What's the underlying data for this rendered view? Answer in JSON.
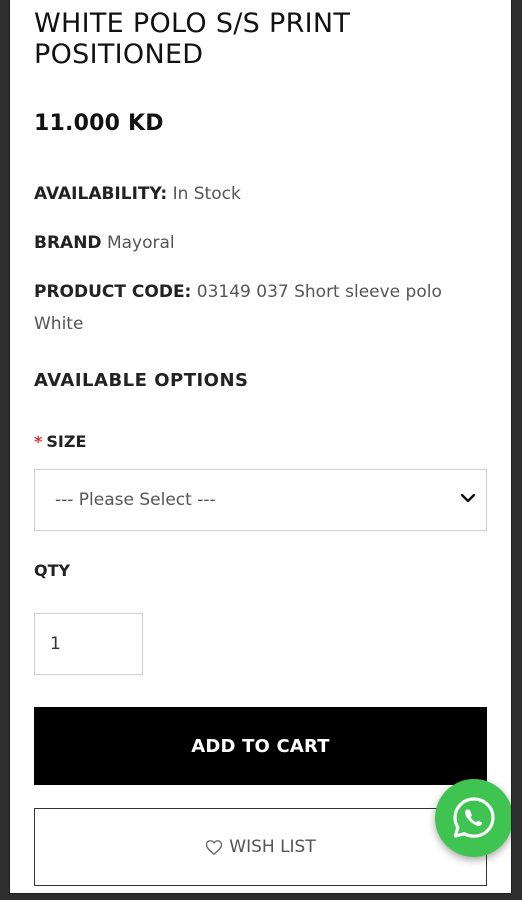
{
  "product": {
    "title_line1": "WHITE POLO S/S PRINT",
    "title_line2": "POSITIONED",
    "price": "11.000 KD",
    "availability_label": "AVAILABILITY:",
    "availability_value": "In Stock",
    "brand_label": "BRAND",
    "brand_value": "Mayoral",
    "code_label": "PRODUCT CODE:",
    "code_value": "03149 037 Short sleeve polo",
    "code_value_cont": "White"
  },
  "options": {
    "heading": "AVAILABLE OPTIONS",
    "size_required_mark": "*",
    "size_label": "SIZE",
    "size_selected": "--- Please Select ---",
    "qty_label": "QTY",
    "qty_value": "1"
  },
  "actions": {
    "add_to_cart": "ADD TO CART",
    "wish_list": "WISH LIST"
  },
  "icons": {
    "dropdown": "chevron-down-icon",
    "wishlist": "heart-outline-icon",
    "chat": "whatsapp-icon"
  },
  "colors": {
    "cart_button_bg": "#000000",
    "whatsapp_green": "#3fc351",
    "required_star": "#e03333"
  }
}
